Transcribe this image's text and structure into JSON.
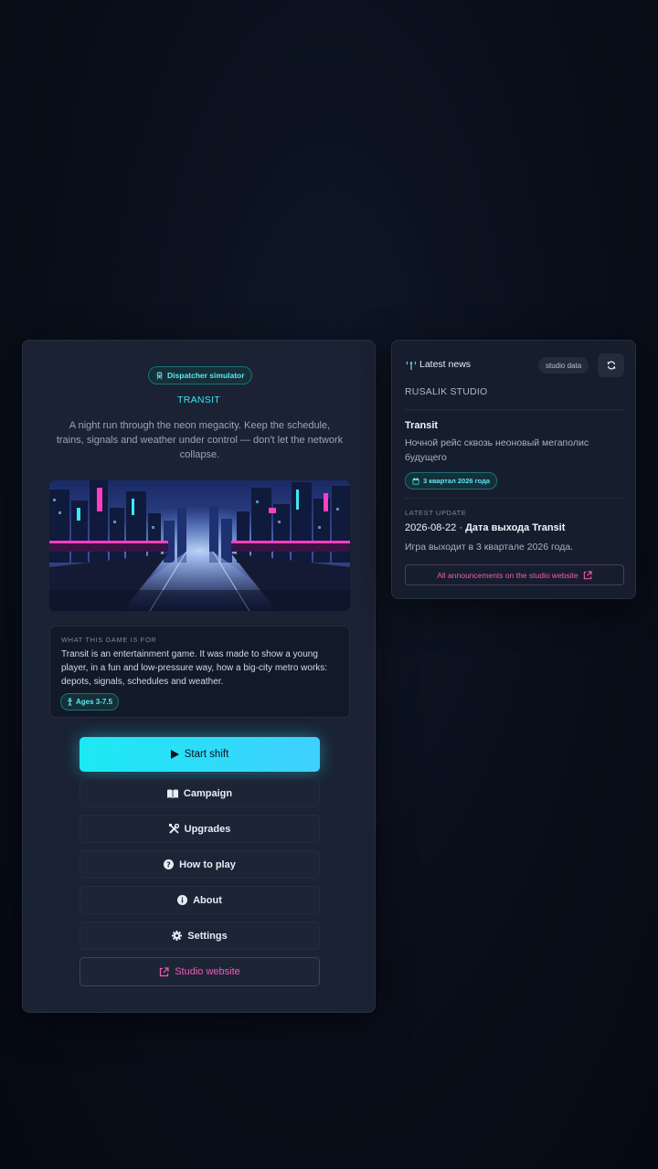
{
  "main": {
    "genre_pill": "Dispatcher simulator",
    "title": "TRANSIT",
    "tagline": "A night run through the neon megacity. Keep the schedule, trains, signals and weather under control — don't let the network collapse.",
    "hero_image": "neon-city-night-railway",
    "purpose": {
      "label": "WHAT THIS GAME IS FOR",
      "text": "Transit is an entertainment game. It was made to show a young player, in a fun and low-pressure way, how a big-city metro works: depots, signals, schedules and weather.",
      "age": "Ages 3-7.5"
    },
    "buttons": {
      "start": "Start shift",
      "campaign": "Campaign",
      "upgrades": "Upgrades",
      "how_to_play": "How to play",
      "about": "About",
      "settings": "Settings",
      "studio_website": "Studio website"
    }
  },
  "news": {
    "heading": "Latest news",
    "studio_data_pill": "studio data",
    "studio_name": "RUSALIK STUDIO",
    "item_title": "Transit",
    "item_desc": "Ночной рейс сквозь неоновый мегаполис будущего",
    "item_badge": "3 квартал 2026 года",
    "latest_label": "LATEST UPDATE",
    "latest_date": "2026-08-22 ·",
    "latest_title": "Дата выхода Transit",
    "latest_desc": "Игра выходит в 3 квартале 2026 года.",
    "announcements_link": "All announcements on the studio website"
  },
  "colors": {
    "accent_cyan": "#1ce9f3",
    "accent_pink": "#f25bb5",
    "card_bg": "#1a2233",
    "page_bg": "#080d18"
  }
}
